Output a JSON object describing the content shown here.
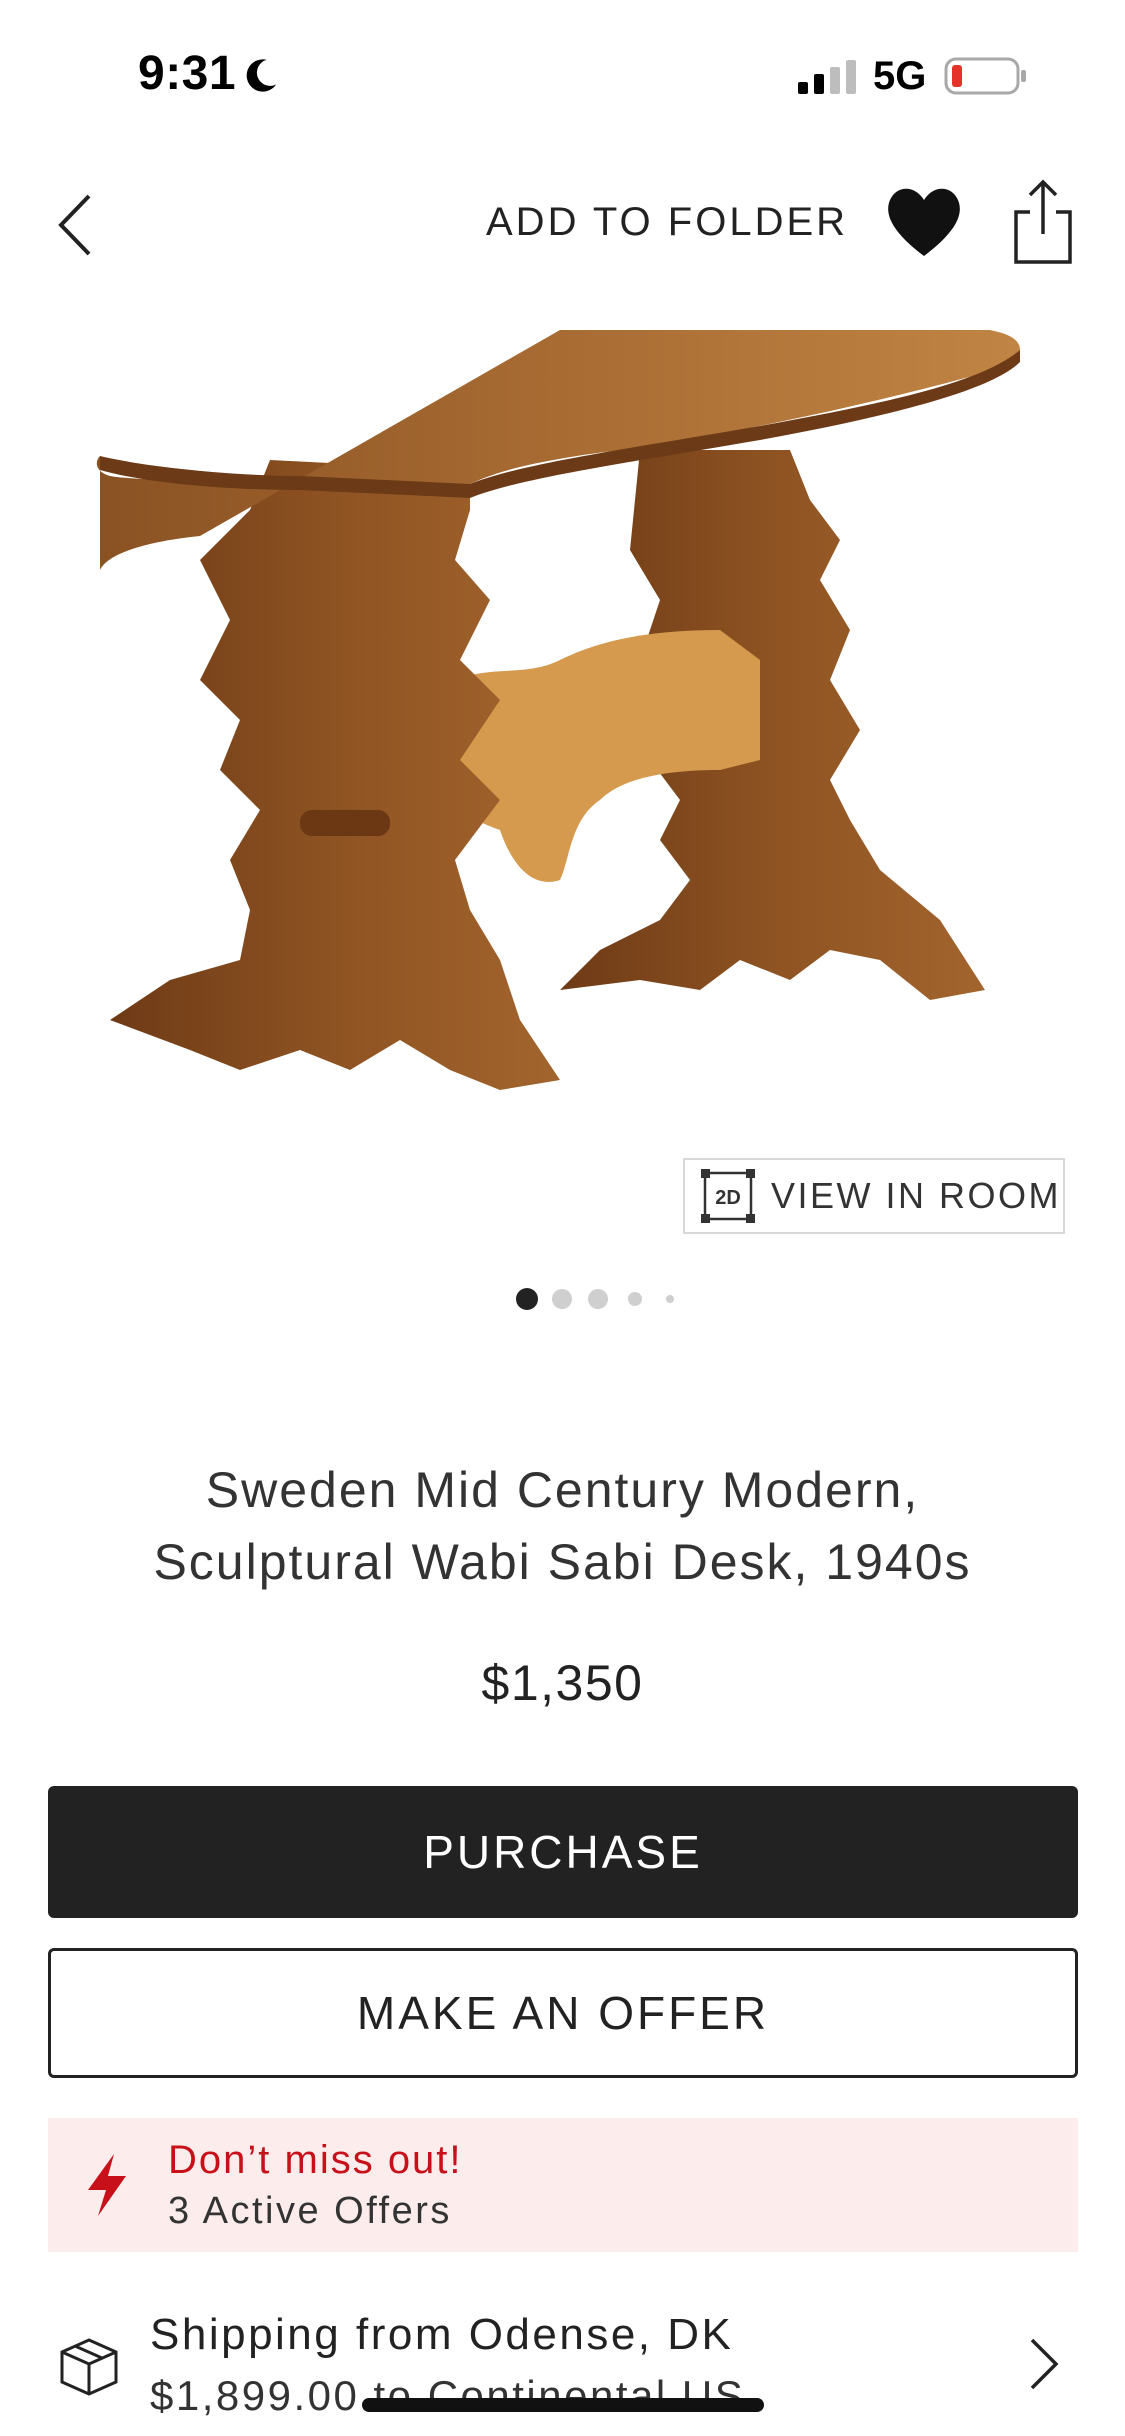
{
  "status_bar": {
    "time": "9:31",
    "network": "5G",
    "battery_color": "#e5332a"
  },
  "nav": {
    "add_to_folder": "ADD TO FOLDER"
  },
  "image": {
    "view_in_room_badge": "2D",
    "view_in_room_label": "VIEW IN ROOM",
    "dots_total": 5,
    "dots_active_index": 0
  },
  "product": {
    "title_line1": "Sweden Mid Century Modern,",
    "title_line2": "Sculptural Wabi Sabi Desk, 1940s",
    "price": "$1,350"
  },
  "actions": {
    "purchase_label": "PURCHASE",
    "offer_label": "MAKE AN OFFER"
  },
  "notice": {
    "title": "Don’t miss out!",
    "subtitle": "3 Active Offers",
    "accent": "#c8101a",
    "background": "#fcecec"
  },
  "shipping": {
    "title": "Shipping from Odense, DK",
    "subtitle": "$1,899.00 to Continental US"
  },
  "icons": [
    "moon-icon",
    "signal-icon",
    "battery-icon",
    "back-chevron-icon",
    "heart-icon",
    "share-icon",
    "view-in-room-icon",
    "lightning-icon",
    "package-icon",
    "chevron-right-icon"
  ]
}
